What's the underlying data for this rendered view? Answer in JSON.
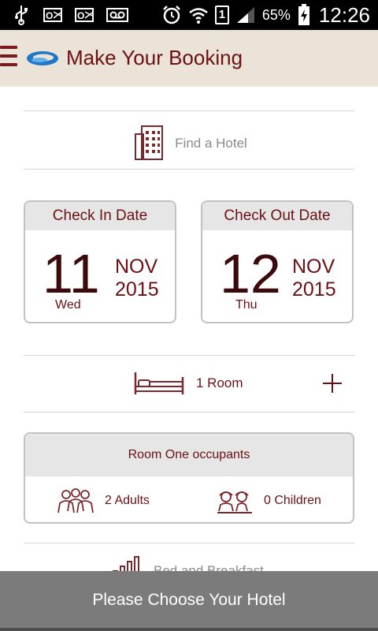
{
  "status_bar": {
    "battery_percent": "65%",
    "time": "12:26",
    "sim_label": "1",
    "icons": [
      "usb-icon",
      "outlook-icon",
      "outlook-icon",
      "voicemail-icon",
      "alarm-icon",
      "wifi-icon",
      "sim-icon",
      "signal-icon",
      "battery-charging-icon"
    ]
  },
  "header": {
    "title": "Make Your Booking"
  },
  "find_hotel": {
    "label": "Find a Hotel"
  },
  "check_in": {
    "title": "Check In Date",
    "day": "11",
    "month": "NOV",
    "year": "2015",
    "weekday": "Wed"
  },
  "check_out": {
    "title": "Check Out Date",
    "day": "12",
    "month": "NOV",
    "year": "2015",
    "weekday": "Thu"
  },
  "rooms": {
    "label": "1 Room"
  },
  "occupants": {
    "title": "Room One occupants",
    "adults": "2 Adults",
    "children": "0 Children"
  },
  "meal": {
    "label": "Bed and Breakfast"
  },
  "bottom_button": {
    "label": "Please Choose Your Hotel"
  },
  "colors": {
    "accent": "#6b1014",
    "header_bg": "#ebe3d7",
    "bottom_bar_bg": "#7b7b7b",
    "card_head_bg": "#e6e6e6"
  }
}
